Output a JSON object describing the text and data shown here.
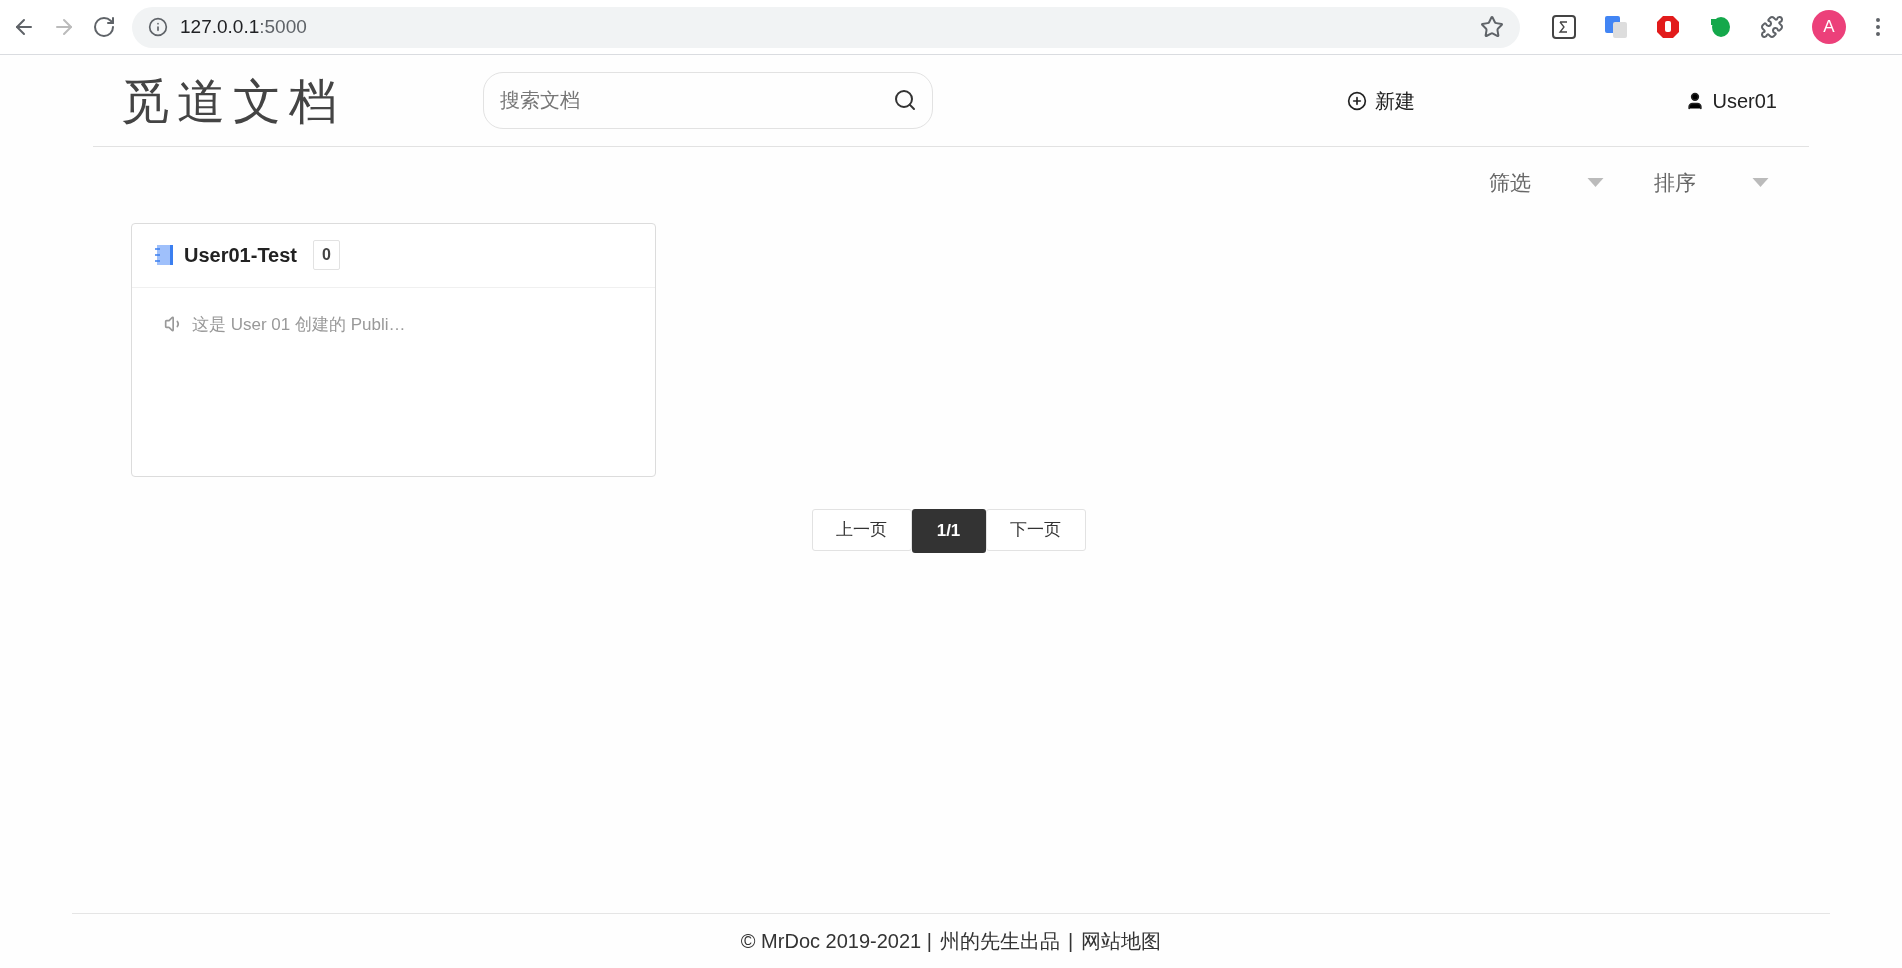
{
  "browser": {
    "url_host": "127.0.0.1",
    "url_port": ":5000",
    "avatar": "A",
    "forward_disabled": true
  },
  "header": {
    "logo": "觅道文档",
    "search": {
      "placeholder": "搜索文档"
    },
    "new": "新建",
    "user": "User01"
  },
  "toolbar": {
    "filters": [
      {
        "label": "筛选"
      },
      {
        "label": "排序"
      }
    ]
  },
  "projects": [
    {
      "title": "User01-Test",
      "count": "0",
      "description": "这是 User 01 创建的 Publi…"
    }
  ],
  "pagination": [
    {
      "label": "上一页",
      "selected": false
    },
    {
      "label": "1/1",
      "selected": true
    },
    {
      "label": "下一页",
      "selected": false
    }
  ],
  "footer": {
    "copyright": "© MrDoc 2019-2021 |",
    "links": [
      "州的先生出品",
      "网站地图"
    ],
    "separator": "|"
  }
}
